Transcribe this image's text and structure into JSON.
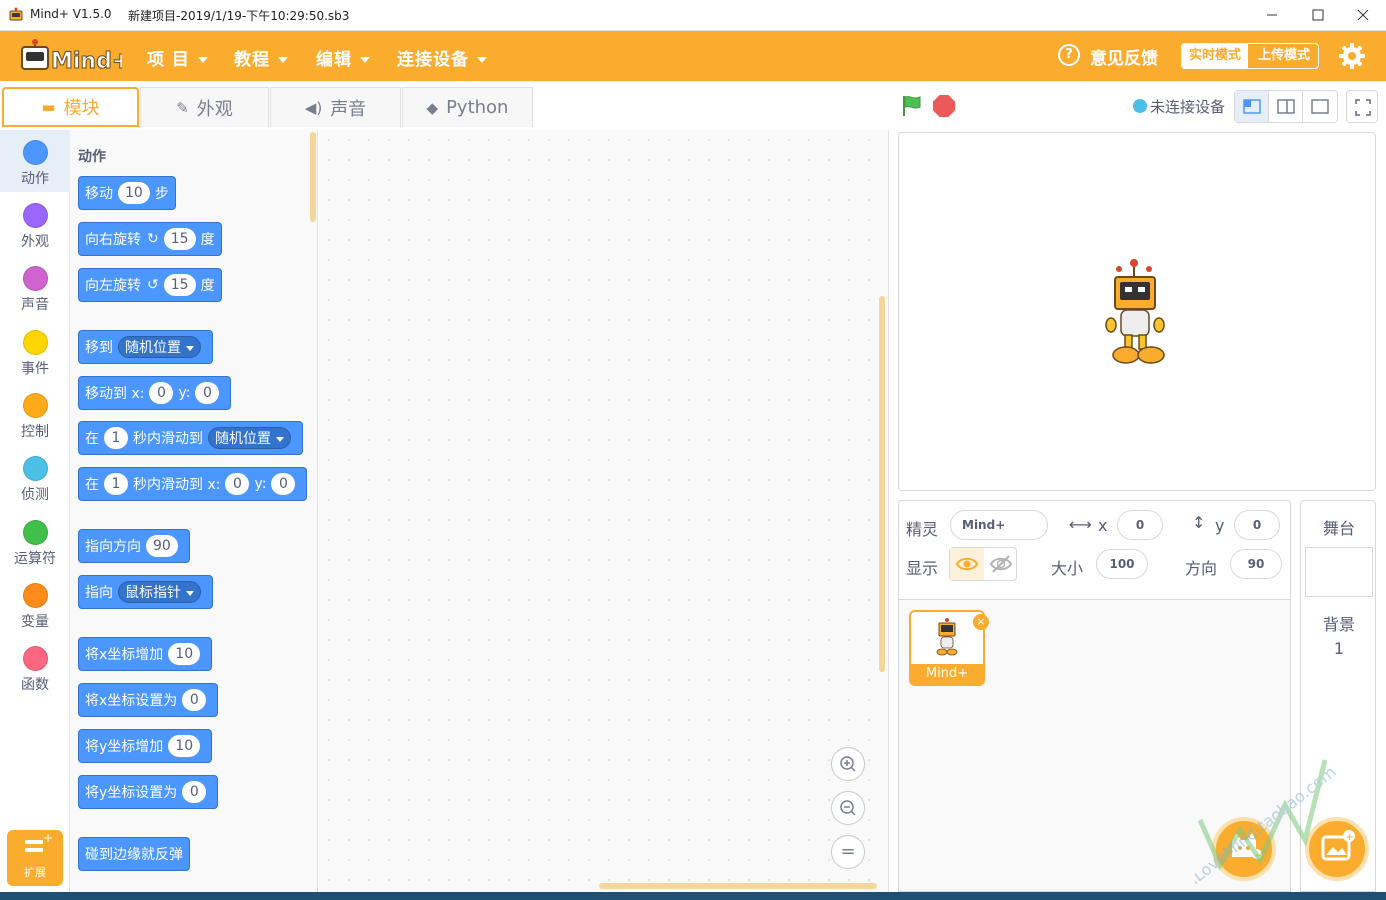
{
  "window": {
    "app_name": "Mind+ V1.5.0",
    "doc_name": "新建项目-2019/1/19-下午10:29:50.sb3"
  },
  "menubar": {
    "logo_text": "Mind+",
    "items": [
      {
        "label": "项 目"
      },
      {
        "label": "教程"
      },
      {
        "label": "编辑"
      },
      {
        "label": "连接设备"
      }
    ],
    "feedback": "意见反馈",
    "mode_realtime": "实时模式",
    "mode_upload": "上传模式",
    "accent": "#f9ac2e"
  },
  "tabs": [
    {
      "label": "模块",
      "icon": "blocks-icon",
      "active": true
    },
    {
      "label": "外观",
      "icon": "brush-icon",
      "active": false
    },
    {
      "label": "声音",
      "icon": "speaker-icon",
      "active": false
    },
    {
      "label": "Python",
      "icon": "python-icon",
      "active": false
    }
  ],
  "categories": [
    {
      "label": "动作",
      "color": "#4c97ff",
      "active": true
    },
    {
      "label": "外观",
      "color": "#9966ff"
    },
    {
      "label": "声音",
      "color": "#cf63cf"
    },
    {
      "label": "事件",
      "color": "#ffd500"
    },
    {
      "label": "控制",
      "color": "#ffab19"
    },
    {
      "label": "侦测",
      "color": "#4cbfe6"
    },
    {
      "label": "运算符",
      "color": "#40bf4a"
    },
    {
      "label": "变量",
      "color": "#ff8c1a"
    },
    {
      "label": "函数",
      "color": "#ff6680"
    }
  ],
  "extension": {
    "label": "扩展"
  },
  "palette": {
    "title": "动作",
    "blocks": {
      "move": {
        "a": "移动",
        "v": "10",
        "b": "步"
      },
      "turn_right": {
        "a": "向右旋转",
        "v": "15",
        "b": "度"
      },
      "turn_left": {
        "a": "向左旋转",
        "v": "15",
        "b": "度"
      },
      "goto": {
        "a": "移到",
        "dd": "随机位置"
      },
      "goto_xy": {
        "a": "移动到 x:",
        "x": "0",
        "b": "y:",
        "y": "0"
      },
      "glide": {
        "a": "在",
        "v": "1",
        "b": "秒内滑动到",
        "dd": "随机位置"
      },
      "glide_xy": {
        "a": "在",
        "v": "1",
        "b": "秒内滑动到 x:",
        "x": "0",
        "c": "y:",
        "y": "0"
      },
      "point_dir": {
        "a": "指向方向",
        "v": "90"
      },
      "point_to": {
        "a": "指向",
        "dd": "鼠标指针"
      },
      "change_x": {
        "a": "将x坐标增加",
        "v": "10"
      },
      "set_x": {
        "a": "将x坐标设置为",
        "v": "0"
      },
      "change_y": {
        "a": "将y坐标增加",
        "v": "10"
      },
      "set_y": {
        "a": "将y坐标设置为",
        "v": "0"
      },
      "bounce": {
        "a": "碰到边缘就反弹"
      }
    }
  },
  "zoom": {
    "reset": "="
  },
  "stage_header": {
    "connection": "未连接设备"
  },
  "sprite": {
    "label_sprite": "精灵",
    "name": "Mind+",
    "label_x": "x",
    "x": "0",
    "label_y": "y",
    "y": "0",
    "label_show": "显示",
    "label_size": "大小",
    "size": "100",
    "label_direction": "方向",
    "direction": "90"
  },
  "sprite_list": [
    {
      "name": "Mind+",
      "selected": true
    }
  ],
  "stage_panel": {
    "title": "舞台",
    "backdrop_label": "背景",
    "backdrop_count": "1"
  },
  "watermark": "iLoveMind.taobao.com"
}
